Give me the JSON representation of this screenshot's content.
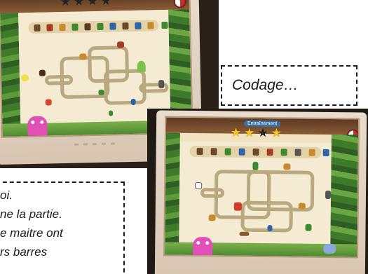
{
  "captions": {
    "coding": "Codage…",
    "explanation_lines": [
      "oi.",
      "ne la partie.",
      "e maitre ont",
      "rs barres"
    ]
  },
  "game_screens": {
    "first": {
      "stars": {
        "filled": 0,
        "total": 4
      }
    },
    "second": {
      "mode_label": "Entraînement",
      "stars": {
        "filled": 3,
        "total": 4
      }
    }
  },
  "colors": {
    "board": "#f4ebd2",
    "road": "#b8aa7e",
    "leaf_frame": "#3f7a2b",
    "mascot": "#e24fb7",
    "star_filled": "#f3c623"
  },
  "icons": {
    "star": "★",
    "timer": "timer-dial-icon"
  }
}
